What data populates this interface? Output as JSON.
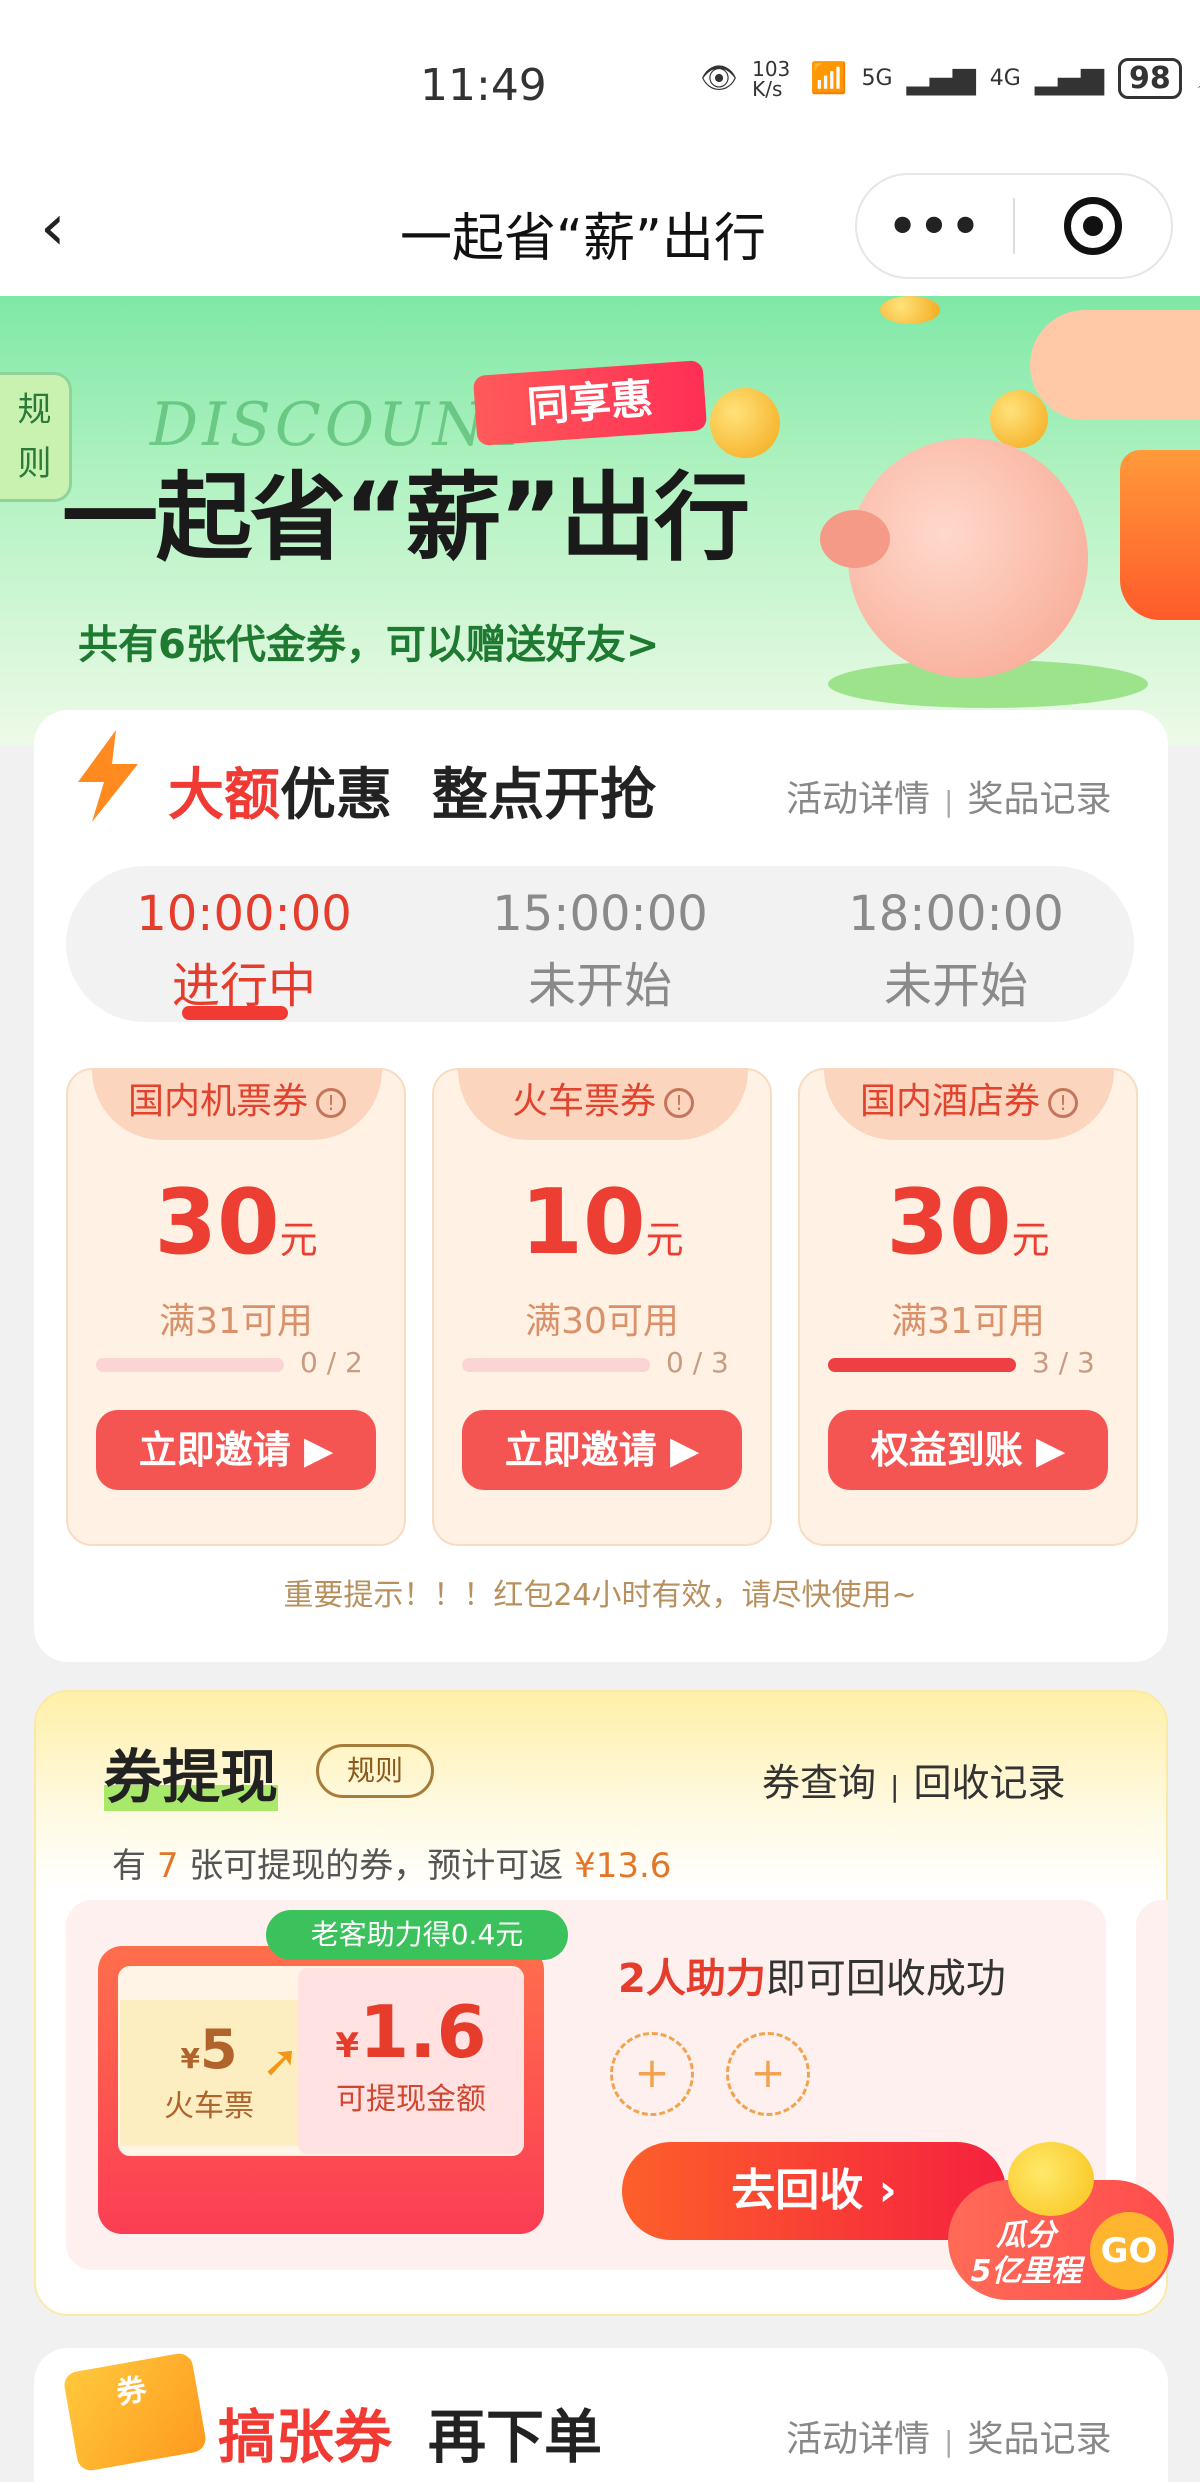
{
  "status_bar": {
    "time": "11:49",
    "net_speed": "103 K/s",
    "signal_labels": [
      "5G",
      "4G"
    ],
    "battery": "98"
  },
  "nav": {
    "title": "一起省“薪”出行"
  },
  "banner": {
    "rules_tab": "规则",
    "discount_script": "DISCOUNT",
    "share_tag": "同享惠",
    "title": "一起省“薪”出行",
    "subtitle": "共有6张代金券，可以赠送好友>"
  },
  "section1": {
    "title_red": "大额",
    "title_rest": "优惠",
    "title_2": "整点开抢",
    "link_details": "活动详情",
    "link_records": "奖品记录",
    "tabs": [
      {
        "time": "10:00:00",
        "status": "进行中",
        "active": true
      },
      {
        "time": "15:00:00",
        "status": "未开始",
        "active": false
      },
      {
        "time": "18:00:00",
        "status": "未开始",
        "active": false
      }
    ],
    "coupons": [
      {
        "name": "国内机票券",
        "amount": "30",
        "unit": "元",
        "condition": "满31可用",
        "progress_text": "0 / 2",
        "progress": 0.0,
        "button": "立即邀请 ▶"
      },
      {
        "name": "火车票券",
        "amount": "10",
        "unit": "元",
        "condition": "满30可用",
        "progress_text": "0 / 3",
        "progress": 0.0,
        "button": "立即邀请 ▶"
      },
      {
        "name": "国内酒店券",
        "amount": "30",
        "unit": "元",
        "condition": "满31可用",
        "progress_text": "3 / 3",
        "progress": 1.0,
        "button": "权益到账 ▶"
      }
    ],
    "tip": "重要提示！！！红包24小时有效，请尽快使用~"
  },
  "section2": {
    "title": "券提现",
    "rules": "规则",
    "link_query": "券查询",
    "link_recycle": "回收记录",
    "sub_prefix": "有",
    "sub_count": "7",
    "sub_middle": "张可提现的券，预计可返",
    "sub_amount": "¥13.6",
    "assist_tag": "老客助力得0.4元",
    "ticket_left_amount": "5",
    "ticket_left_label": "火车票",
    "ticket_right_amount": "1.6",
    "ticket_right_label": "可提现金额",
    "currency": "¥",
    "assist_red": "2人助力",
    "assist_rest": "即可回收成功",
    "plus": "+",
    "button": "去回收 ›"
  },
  "float_badge": {
    "line1": "瓜分",
    "line2": "5亿里程",
    "go": "GO"
  },
  "section3": {
    "voucher": "券",
    "title_red": "搞张券",
    "title_rest": "再下单",
    "link_details": "活动详情",
    "link_records": "奖品记录"
  },
  "colors": {
    "accent_red": "#f03a33",
    "green_banner": "#7fe8a6",
    "orange": "#e2772a"
  }
}
